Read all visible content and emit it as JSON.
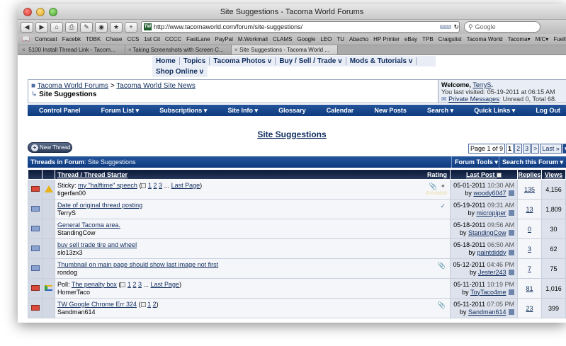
{
  "window": {
    "title": "Site Suggestions - Tacoma World Forums",
    "url": "http://www.tacomaworld.com/forum/site-suggestions/",
    "rss_label": "RSS",
    "search_placeholder": "Google"
  },
  "bookmarks": [
    "Comcast",
    "Facebk",
    "TDBK",
    "Chase",
    "CCS",
    "1st Cit",
    "CCCC",
    "FastLane",
    "PayPal",
    "M.Workmail",
    "CLAMS",
    "Google",
    "LEO",
    "TU",
    "Abacho",
    "HP Printer",
    "eBay",
    "TPB",
    "Craigslist",
    "Tacoma World",
    "Tacoma▾",
    "M/C▾",
    "Fuelly"
  ],
  "tabs": [
    "5100 Install Thread Link - Tacom...",
    "Taking Screenshots with Screen C...",
    "Site Suggestions - Tacoma World ..."
  ],
  "topnav": {
    "row1": [
      "Home",
      "Topics",
      "Tacoma Photos v",
      "Buy / Sell / Trade v",
      "Mods & Tutorials v"
    ],
    "row2": "Shop Online v"
  },
  "breadcrumb": {
    "parent1": "Tacoma World Forums",
    "separator": ">",
    "parent2": "Tacoma World Site News",
    "current": "Site Suggestions"
  },
  "userbox": {
    "welcome_prefix": "Welcome, ",
    "username": "TerryS",
    "welcome_suffix": ".",
    "last_visited_prefix": "You last visited: ",
    "last_visited_date": "05-19-2011",
    "last_visited_at": " at ",
    "last_visited_time": "06:15 AM",
    "pm_link": "Private Messages",
    "pm_status": ": Unread 0, Total 68."
  },
  "navbar": [
    "Control Panel",
    "Forum List ▾",
    "Subscriptions ▾",
    "Site Info ▾",
    "Glossary",
    "Calendar",
    "New Posts",
    "Search ▾",
    "Quick Links ▾",
    "Log Out"
  ],
  "forum_title": "Site Suggestions",
  "new_thread_label": "New Thread",
  "pager": {
    "label": "Page 1 of 9",
    "pages": [
      "1",
      "2",
      "3"
    ],
    "next": ">",
    "last": "Last »",
    "menu": "▾"
  },
  "threads_header": {
    "label": "Threads in Forum",
    "forum_name": " : Site Suggestions",
    "forum_tools": "Forum Tools ▾",
    "search_forum": "Search this Forum ▾"
  },
  "columns": {
    "thread": "Thread",
    "slash": " / ",
    "starter": "Thread Starter",
    "rating": "Rating",
    "last_post": "Last Post",
    "replies": "Replies",
    "views": "Views"
  },
  "threads": [
    {
      "prefix": "Sticky: ",
      "title": "my \"halftime\" speech",
      "pages": [
        "1",
        "2",
        "3"
      ],
      "last_page": "Last Page",
      "starter": "tigerfan00",
      "date": "05-01-2011",
      "time": "10:30 AM",
      "by": "by ",
      "last_user": "woody6047",
      "replies": "135",
      "views": "4,156",
      "status": "red",
      "icon": "warn",
      "rating": "☆☆☆☆☆"
    },
    {
      "prefix": "",
      "title": "Date of original thread posting",
      "pages": [],
      "last_page": "",
      "starter": "TerryS",
      "date": "05-19-2011",
      "time": "09:31 AM",
      "by": "by ",
      "last_user": "micropiper",
      "replies": "13",
      "views": "1,809",
      "status": "blue",
      "icon": "",
      "rating": ""
    },
    {
      "prefix": "",
      "title": "General Tacoma area.",
      "pages": [],
      "last_page": "",
      "starter": "StandingCow",
      "date": "05-18-2011",
      "time": "09:56 AM",
      "by": "by ",
      "last_user": "StandingCow",
      "replies": "0",
      "views": "30",
      "status": "blue",
      "icon": "",
      "rating": ""
    },
    {
      "prefix": "",
      "title": "buy sell trade tire and wheel",
      "pages": [],
      "last_page": "",
      "starter": "slo13zx3",
      "date": "05-18-2011",
      "time": "06:50 AM",
      "by": "by ",
      "last_user": "paintdiddy",
      "replies": "3",
      "views": "62",
      "status": "blue",
      "icon": "",
      "rating": ""
    },
    {
      "prefix": "",
      "title": "Thumbnail on main page should show last image not first",
      "pages": [],
      "last_page": "",
      "starter": "rondog",
      "date": "05-12-2011",
      "time": "04:46 PM",
      "by": "by ",
      "last_user": "Jester243",
      "replies": "7",
      "views": "75",
      "status": "blue",
      "icon": "",
      "rating": ""
    },
    {
      "prefix": "Poll: ",
      "title": "The penalty box",
      "pages": [
        "1",
        "2",
        "3"
      ],
      "last_page": "Last Page",
      "starter": "HomerTaco",
      "date": "05-11-2011",
      "time": "10:19 PM",
      "by": "by ",
      "last_user": "ToyTaco4me",
      "replies": "81",
      "views": "1,016",
      "status": "red",
      "icon": "poll",
      "rating": ""
    },
    {
      "prefix": "",
      "title": "TW Google Chrome Err 324",
      "pages": [
        "1",
        "2"
      ],
      "last_page": "",
      "starter": "Sandman614",
      "date": "05-11-2011",
      "time": "07:05 PM",
      "by": "by ",
      "last_user": "Sandman614",
      "replies": "23",
      "views": "399",
      "status": "red",
      "icon": "",
      "rating": ""
    }
  ]
}
